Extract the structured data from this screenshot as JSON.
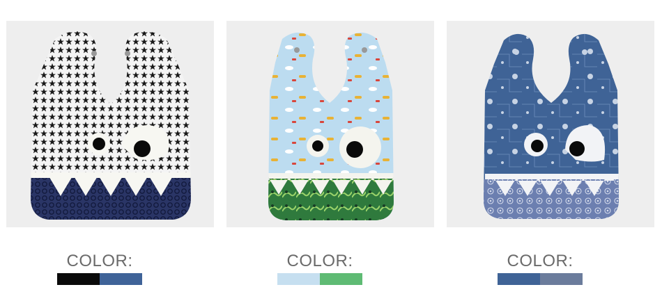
{
  "products": [
    {
      "name": "bib-black-stars",
      "color_label": "COLOR:",
      "swatches": [
        "#0a0a0a",
        "#3f6398"
      ]
    },
    {
      "name": "bib-light-blue-airplanes",
      "color_label": "COLOR:",
      "swatches": [
        "#c6dff0",
        "#5fbb74"
      ]
    },
    {
      "name": "bib-navy-space",
      "color_label": "COLOR:",
      "swatches": [
        "#3f6396",
        "#6b7c9c"
      ]
    }
  ]
}
